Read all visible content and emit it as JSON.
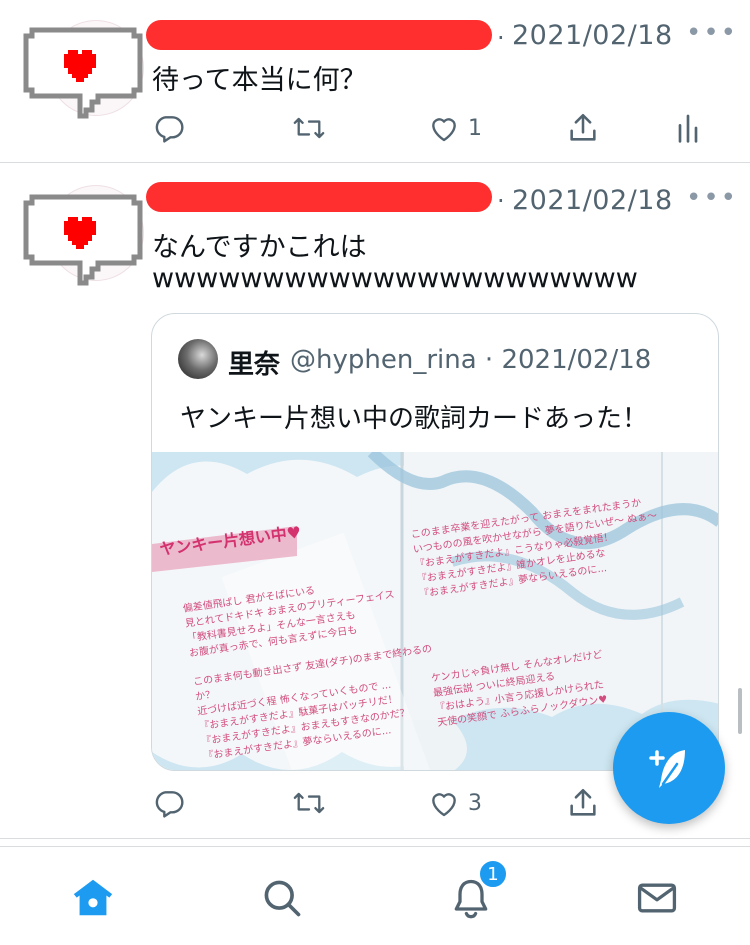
{
  "tweets": [
    {
      "date": "2021/02/18",
      "text_lines": [
        "待って本当に何？"
      ],
      "actions": {
        "reply_count": "",
        "retweet_count": "",
        "like_count": "1"
      }
    },
    {
      "date": "2021/02/18",
      "text_lines": [
        "なんですかこれは",
        "wwwwwwwwwwwwwwwwwwwwww"
      ],
      "actions": {
        "reply_count": "",
        "retweet_count": "",
        "like_count": "3"
      },
      "quote": {
        "name": "里奈",
        "handle": "@hyphen_rina",
        "date": "2021/02/18",
        "text": "ヤンキー片想い中の歌詞カードあった！",
        "image": {
          "title": "ヤンキー片想い中♥",
          "lyrics": [
            "偏差値飛ばし 君がそばにいる",
            "見とれてドキドキ おまえのプリティーフェイス",
            "「教科書見せろよ」そんな一言さえも",
            "お腹が真っ赤で、何も言えずに今日も",
            "このまま何も動き出さず 友達(ダチ)のままで終わるのか？",
            "近づけば近づく程 怖くなっていくもので ...",
            "『おまえがすきだよ』駄菓子はパッチリだ！",
            "『おまえがすきだよ』おまえもすきなのかだ？",
            "『おまえがすきだよ』夢ならいえるのに...",
            "このまま卒業を迎えたがって おまえをまれたまうか",
            "いつものの風を吹かせながら 夢を語りたいぜ〜 ぬぁ〜",
            "『おまえがすきだよ』こうなりゃ必殺覚悟！",
            "『おまえがすきだよ』誰かオレを止めるな",
            "『おまえがすきだよ』夢ならいえるのに...",
            "ケンカじゃ負け無し そんなオレだけど",
            "最強伝説 ついに終局迎える",
            "『おはよう』小言う応援しかけられた",
            "天使の笑顔で ふらふらノックダウン♥"
          ]
        }
      }
    }
  ],
  "fab": {
    "icon": "compose-feather-icon"
  },
  "tabbar": {
    "items": [
      "home-icon",
      "search-icon",
      "notifications-icon",
      "messages-icon"
    ],
    "notification_badge": "1"
  },
  "colors": {
    "accent": "#1d9bf0",
    "redaction": "#ff2f2f",
    "heart_icon": "#ff0000"
  }
}
